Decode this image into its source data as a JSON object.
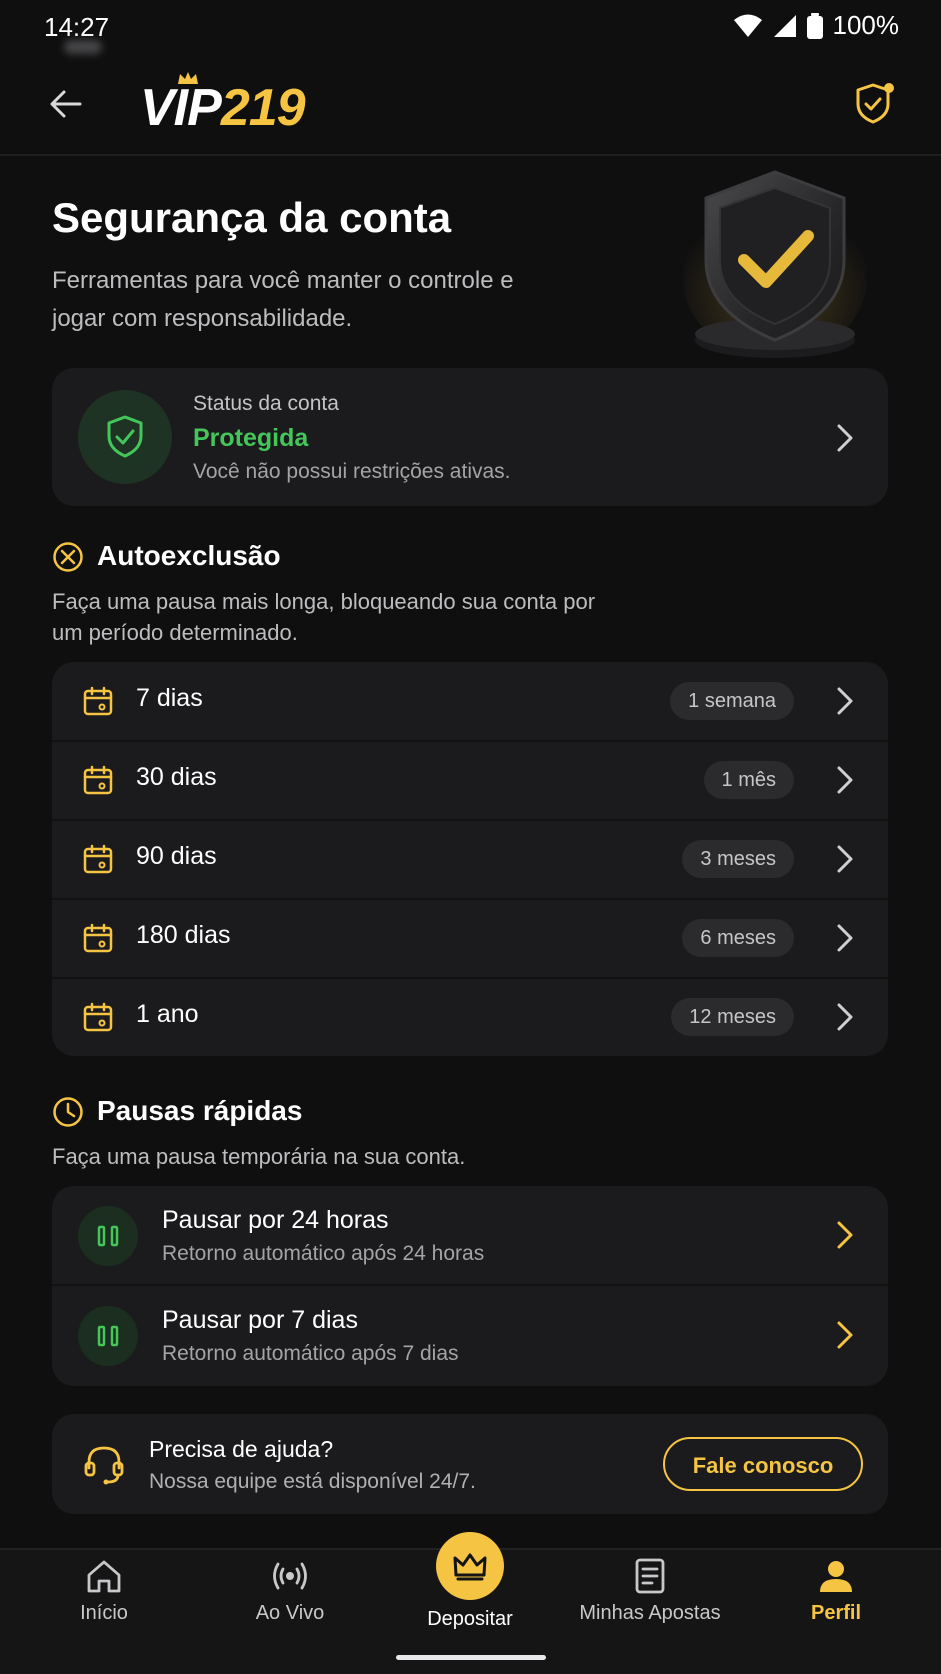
{
  "status_bar": {
    "time": "14:27",
    "battery": "100%"
  },
  "header": {
    "logo_vip": "VIP",
    "logo_number": "219"
  },
  "hero": {
    "title": "Segurança da conta",
    "subtitle": "Ferramentas para você manter o controle e jogar com responsabilidade."
  },
  "account_status": {
    "label": "Status da conta",
    "value": "Protegida",
    "description": "Você não possui restrições ativas."
  },
  "self_exclusion": {
    "title": "Autoexclusão",
    "description": "Faça uma pausa mais longa, bloqueando sua conta por um período determinado.",
    "options": [
      {
        "label": "7 dias",
        "badge": "1 semana"
      },
      {
        "label": "30 dias",
        "badge": "1 mês"
      },
      {
        "label": "90 dias",
        "badge": "3 meses"
      },
      {
        "label": "180 dias",
        "badge": "6 meses"
      },
      {
        "label": "1 ano",
        "badge": "12 meses"
      }
    ]
  },
  "quick_pauses": {
    "title": "Pausas rápidas",
    "description": "Faça uma pausa temporária na sua conta.",
    "options": [
      {
        "title": "Pausar por 24 horas",
        "description": "Retorno automático após 24 horas"
      },
      {
        "title": "Pausar por 7 dias",
        "description": "Retorno automático após 7 dias"
      }
    ]
  },
  "help": {
    "title": "Precisa de ajuda?",
    "description": "Nossa equipe está disponível 24/7.",
    "button": "Fale conosco"
  },
  "bottom_nav": [
    {
      "label": "Início",
      "icon": "home-icon"
    },
    {
      "label": "Ao Vivo",
      "icon": "live-icon"
    },
    {
      "label": "Depositar",
      "icon": "crown-icon"
    },
    {
      "label": "Minhas Apostas",
      "icon": "bets-icon"
    },
    {
      "label": "Perfil",
      "icon": "profile-icon"
    }
  ],
  "colors": {
    "accent": "#f5c443",
    "success": "#44c65a",
    "background": "#0f0f10",
    "card": "#1b1b1d"
  }
}
